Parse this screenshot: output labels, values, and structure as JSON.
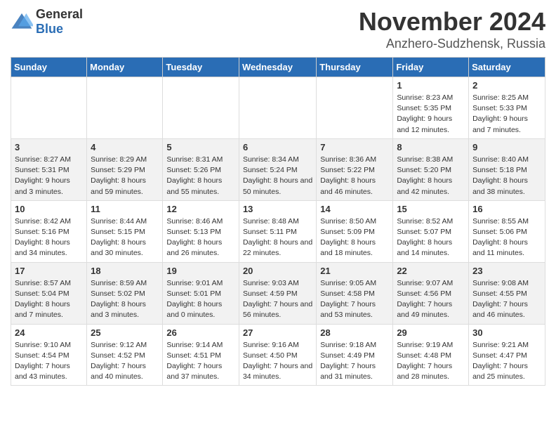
{
  "header": {
    "logo_general": "General",
    "logo_blue": "Blue",
    "month_title": "November 2024",
    "location": "Anzhero-Sudzhensk, Russia"
  },
  "days_of_week": [
    "Sunday",
    "Monday",
    "Tuesday",
    "Wednesday",
    "Thursday",
    "Friday",
    "Saturday"
  ],
  "weeks": [
    [
      {
        "day": "",
        "info": ""
      },
      {
        "day": "",
        "info": ""
      },
      {
        "day": "",
        "info": ""
      },
      {
        "day": "",
        "info": ""
      },
      {
        "day": "",
        "info": ""
      },
      {
        "day": "1",
        "info": "Sunrise: 8:23 AM\nSunset: 5:35 PM\nDaylight: 9 hours and 12 minutes."
      },
      {
        "day": "2",
        "info": "Sunrise: 8:25 AM\nSunset: 5:33 PM\nDaylight: 9 hours and 7 minutes."
      }
    ],
    [
      {
        "day": "3",
        "info": "Sunrise: 8:27 AM\nSunset: 5:31 PM\nDaylight: 9 hours and 3 minutes."
      },
      {
        "day": "4",
        "info": "Sunrise: 8:29 AM\nSunset: 5:29 PM\nDaylight: 8 hours and 59 minutes."
      },
      {
        "day": "5",
        "info": "Sunrise: 8:31 AM\nSunset: 5:26 PM\nDaylight: 8 hours and 55 minutes."
      },
      {
        "day": "6",
        "info": "Sunrise: 8:34 AM\nSunset: 5:24 PM\nDaylight: 8 hours and 50 minutes."
      },
      {
        "day": "7",
        "info": "Sunrise: 8:36 AM\nSunset: 5:22 PM\nDaylight: 8 hours and 46 minutes."
      },
      {
        "day": "8",
        "info": "Sunrise: 8:38 AM\nSunset: 5:20 PM\nDaylight: 8 hours and 42 minutes."
      },
      {
        "day": "9",
        "info": "Sunrise: 8:40 AM\nSunset: 5:18 PM\nDaylight: 8 hours and 38 minutes."
      }
    ],
    [
      {
        "day": "10",
        "info": "Sunrise: 8:42 AM\nSunset: 5:16 PM\nDaylight: 8 hours and 34 minutes."
      },
      {
        "day": "11",
        "info": "Sunrise: 8:44 AM\nSunset: 5:15 PM\nDaylight: 8 hours and 30 minutes."
      },
      {
        "day": "12",
        "info": "Sunrise: 8:46 AM\nSunset: 5:13 PM\nDaylight: 8 hours and 26 minutes."
      },
      {
        "day": "13",
        "info": "Sunrise: 8:48 AM\nSunset: 5:11 PM\nDaylight: 8 hours and 22 minutes."
      },
      {
        "day": "14",
        "info": "Sunrise: 8:50 AM\nSunset: 5:09 PM\nDaylight: 8 hours and 18 minutes."
      },
      {
        "day": "15",
        "info": "Sunrise: 8:52 AM\nSunset: 5:07 PM\nDaylight: 8 hours and 14 minutes."
      },
      {
        "day": "16",
        "info": "Sunrise: 8:55 AM\nSunset: 5:06 PM\nDaylight: 8 hours and 11 minutes."
      }
    ],
    [
      {
        "day": "17",
        "info": "Sunrise: 8:57 AM\nSunset: 5:04 PM\nDaylight: 8 hours and 7 minutes."
      },
      {
        "day": "18",
        "info": "Sunrise: 8:59 AM\nSunset: 5:02 PM\nDaylight: 8 hours and 3 minutes."
      },
      {
        "day": "19",
        "info": "Sunrise: 9:01 AM\nSunset: 5:01 PM\nDaylight: 8 hours and 0 minutes."
      },
      {
        "day": "20",
        "info": "Sunrise: 9:03 AM\nSunset: 4:59 PM\nDaylight: 7 hours and 56 minutes."
      },
      {
        "day": "21",
        "info": "Sunrise: 9:05 AM\nSunset: 4:58 PM\nDaylight: 7 hours and 53 minutes."
      },
      {
        "day": "22",
        "info": "Sunrise: 9:07 AM\nSunset: 4:56 PM\nDaylight: 7 hours and 49 minutes."
      },
      {
        "day": "23",
        "info": "Sunrise: 9:08 AM\nSunset: 4:55 PM\nDaylight: 7 hours and 46 minutes."
      }
    ],
    [
      {
        "day": "24",
        "info": "Sunrise: 9:10 AM\nSunset: 4:54 PM\nDaylight: 7 hours and 43 minutes."
      },
      {
        "day": "25",
        "info": "Sunrise: 9:12 AM\nSunset: 4:52 PM\nDaylight: 7 hours and 40 minutes."
      },
      {
        "day": "26",
        "info": "Sunrise: 9:14 AM\nSunset: 4:51 PM\nDaylight: 7 hours and 37 minutes."
      },
      {
        "day": "27",
        "info": "Sunrise: 9:16 AM\nSunset: 4:50 PM\nDaylight: 7 hours and 34 minutes."
      },
      {
        "day": "28",
        "info": "Sunrise: 9:18 AM\nSunset: 4:49 PM\nDaylight: 7 hours and 31 minutes."
      },
      {
        "day": "29",
        "info": "Sunrise: 9:19 AM\nSunset: 4:48 PM\nDaylight: 7 hours and 28 minutes."
      },
      {
        "day": "30",
        "info": "Sunrise: 9:21 AM\nSunset: 4:47 PM\nDaylight: 7 hours and 25 minutes."
      }
    ]
  ]
}
